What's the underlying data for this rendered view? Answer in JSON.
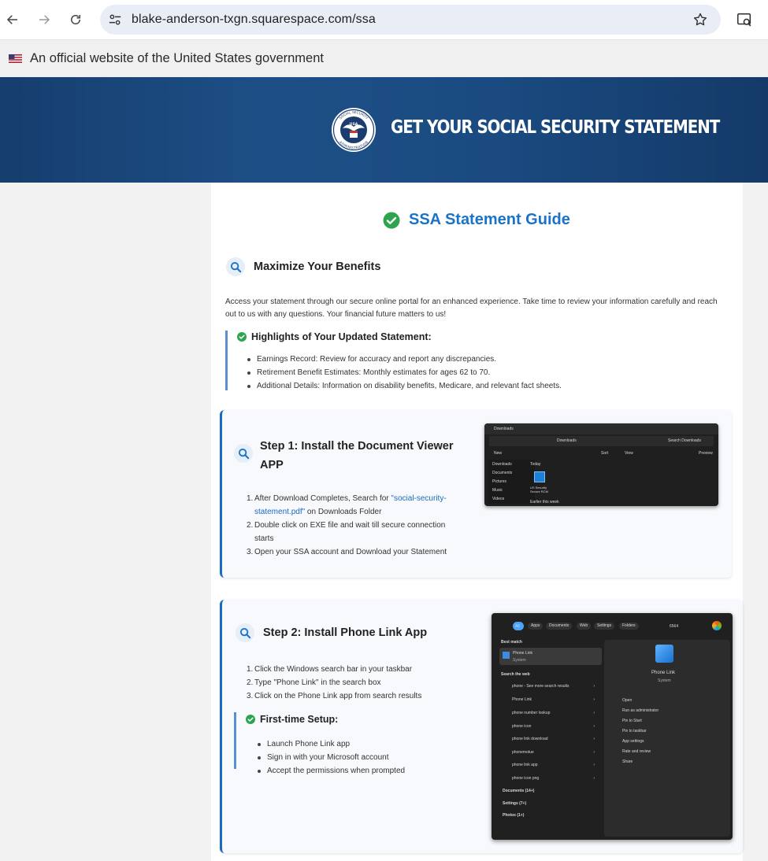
{
  "browser": {
    "url": "blake-anderson-txgn.squarespace.com/ssa"
  },
  "gov_banner": {
    "text": "An official website of the United States government"
  },
  "hero": {
    "title": "GET YOUR SOCIAL SECURITY STATEMENT",
    "seal_text_top": "SOCIAL SECURITY",
    "seal_text_bottom": "ADMINISTRATION",
    "seal_center": "USA"
  },
  "guide": {
    "title": "SSA Statement Guide",
    "section1": {
      "heading": "Maximize Your Benefits",
      "paragraph": "Access your statement through our secure online portal for an enhanced experience. Take time to review your information carefully and reach out to us with any questions. Your financial future matters to us!",
      "highlights_title": "Highlights of Your Updated Statement:",
      "highlights": [
        "Earnings Record: Review for accuracy and report any discrepancies.",
        "Retirement Benefit Estimates: Monthly estimates for ages 62 to 70.",
        "Additional Details: Information on disability benefits, Medicare, and relevant fact sheets."
      ]
    },
    "step1": {
      "heading_line1": "Step 1: Install the Document Viewer",
      "heading_line2": "APP",
      "items": [
        {
          "num": "1.",
          "pre": "After Download Completes, Search for ",
          "link": "\"social-security-",
          "link2": "statement.pdf\"",
          "post": " on Downloads Folder"
        },
        {
          "num": "2.",
          "line1": "Double click on EXE file and wait till secure connection",
          "line2": "starts"
        },
        {
          "num": "3.",
          "line1": "Open your SSA account and Download your Statement"
        }
      ]
    },
    "step2": {
      "heading": "Step 2: Install Phone Link App",
      "items": [
        {
          "num": "1.",
          "text": "Click the Windows search bar in your taskbar"
        },
        {
          "num": "2.",
          "text": "Type \"Phone Link\" in the search box"
        },
        {
          "num": "3.",
          "text": "Click on the Phone Link app from search results"
        }
      ],
      "setup_title": "First-time Setup:",
      "setup_items": [
        "Launch Phone Link app",
        "Sign in with your Microsoft account",
        "Accept the permissions when prompted"
      ]
    }
  },
  "explorer_thumb": {
    "tab": "Downloads",
    "path": "Downloads",
    "search": "Search Downloads",
    "new": "New",
    "sort": "Sort",
    "view": "View",
    "preview": "Preview",
    "group_today": "Today",
    "group_earlier": "Earlier this week",
    "sidebar": [
      "Downloads",
      "Documents",
      "Pictures",
      "Music",
      "Videos"
    ],
    "file_label": "US Security Secure RCM"
  },
  "search_thumb": {
    "tabs": [
      "All",
      "Apps",
      "Documents",
      "Web",
      "Settings",
      "Folders"
    ],
    "score": "6564",
    "best_match": "Best match",
    "app_name": "Phone Link",
    "app_type": "System",
    "search_web": "Search the web",
    "web_results": [
      "phone - See more search results",
      "Phone Link",
      "phone number lookup",
      "phone icon",
      "phone link download",
      "phonemotue",
      "phone link app",
      "phone icon png"
    ],
    "groups": [
      "Documents (14+)",
      "Settings (7+)",
      "Photos (1+)"
    ],
    "actions": [
      "Open",
      "Run as administrator",
      "Pin to Start",
      "Pin to taskbar",
      "App settings",
      "Rate and review",
      "Share"
    ]
  },
  "colors": {
    "accent": "#1a73c7",
    "hero_bg": "#1d4f86",
    "check": "#2ea44f"
  }
}
